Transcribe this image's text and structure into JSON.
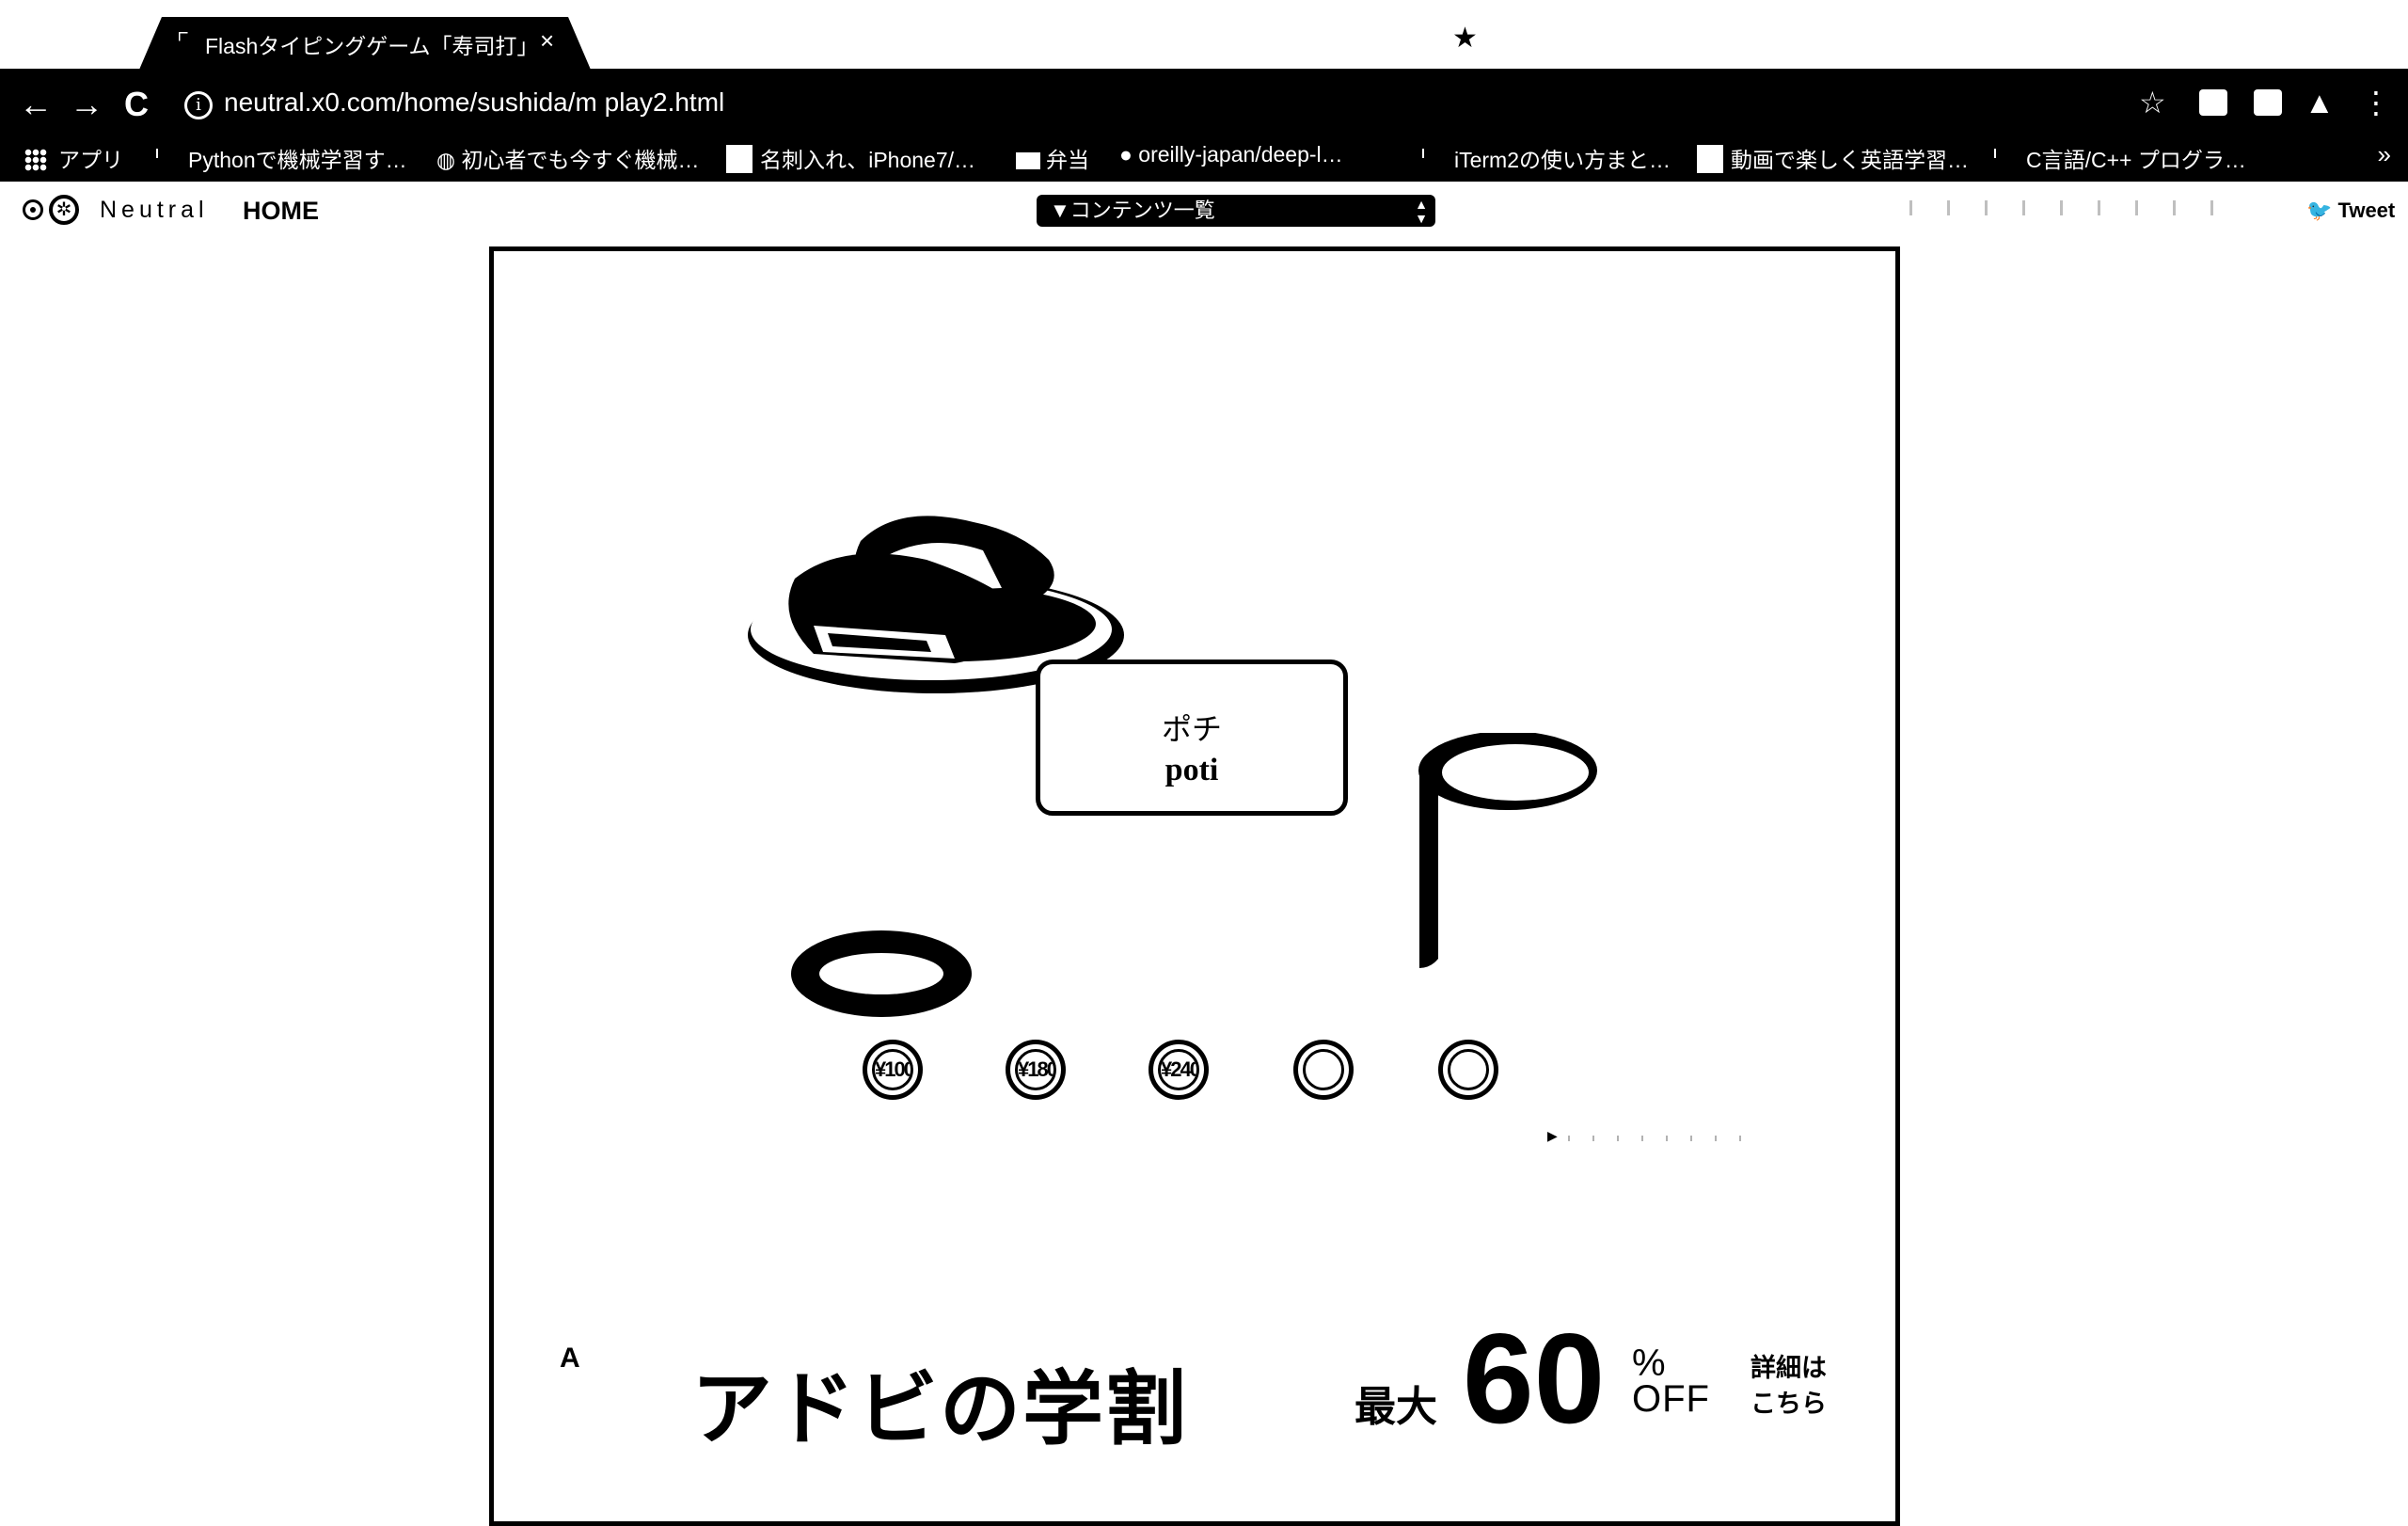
{
  "tab": {
    "title": "Flashタイピングゲーム「寿司打」",
    "close": "×"
  },
  "toolbar": {
    "back": "←",
    "forward": "→",
    "reload": "C",
    "info": "i",
    "url": "neutral.x0.com/home/sushida/m  play2.html",
    "bookmark_star": "☆",
    "menu": "⋮"
  },
  "bookmarks": {
    "apps": "アプリ",
    "items": [
      "Pythonで機械学習す…",
      "初心者でも今すぐ機械…",
      "名刺入れ、iPhone7/…",
      "弁当",
      "oreilly-japan/deep-l…",
      "iTerm2の使い方まと…",
      "動画で楽しく英語学習…",
      "C言語/C++ プログラ…"
    ],
    "more": "»"
  },
  "site": {
    "logo_text": "Neutral",
    "home": "HOME",
    "contents_select": "▼コンテンツ一覧",
    "tweet": "Tweet"
  },
  "game": {
    "word_kana": "ポチ",
    "word_romaji": "poti",
    "coins": [
      "¥100",
      "¥180",
      "¥240",
      "",
      ""
    ]
  },
  "ad": {
    "logo": "A",
    "headline": "アドビの学割",
    "max": "最大",
    "number": "60",
    "percent": "%",
    "off": "OFF",
    "detail": "詳細はこちら"
  }
}
